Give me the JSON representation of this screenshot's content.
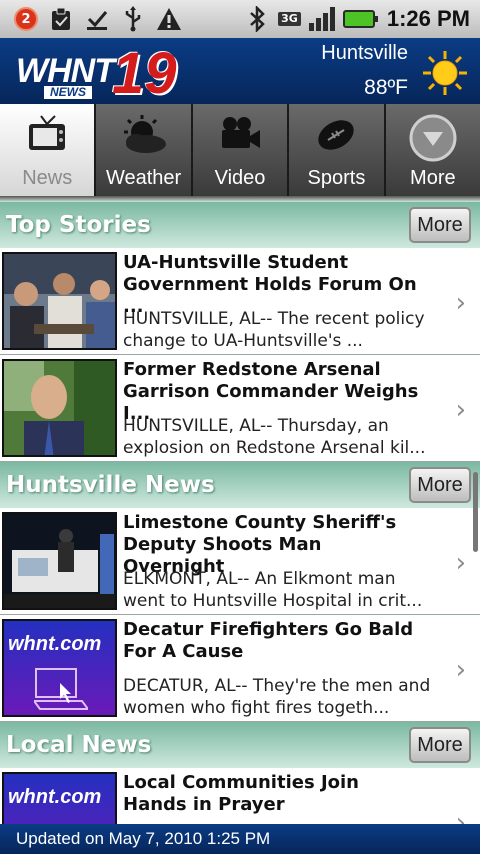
{
  "status_bar": {
    "notification_count": "2",
    "network_label": "3G",
    "time": "1:26 PM",
    "icons": [
      "notification-badge",
      "clipboard-icon",
      "download-done-icon",
      "usb-icon",
      "warning-icon",
      "bluetooth-icon",
      "3g-icon",
      "signal-icon",
      "battery-icon"
    ]
  },
  "header": {
    "logo_text": "WHNT",
    "logo_number": "19",
    "logo_subtext": "NEWS",
    "city": "Huntsville",
    "temperature": "88ºF",
    "weather_icon": "sun-icon"
  },
  "tabs": [
    {
      "label": "News",
      "icon": "tv-icon",
      "active": true
    },
    {
      "label": "Weather",
      "icon": "cloud-sun-icon",
      "active": false
    },
    {
      "label": "Video",
      "icon": "video-camera-icon",
      "active": false
    },
    {
      "label": "Sports",
      "icon": "football-icon",
      "active": false
    },
    {
      "label": "More",
      "icon": "more-down-icon",
      "active": false
    }
  ],
  "sections": [
    {
      "title": "Top Stories",
      "more_label": "More",
      "stories": [
        {
          "title": "UA-Huntsville Student Government Holds Forum On ...",
          "desc": "HUNTSVILLE, AL-- The recent policy change to UA-Huntsville's ..."
        },
        {
          "title": "Former Redstone Arsenal Garrison Commander Weighs I...",
          "desc": "HUNTSVILLE, AL-- Thursday, an explosion on Redstone Arsenal kil..."
        }
      ]
    },
    {
      "title": "Huntsville News",
      "more_label": "More",
      "stories": [
        {
          "title": "Limestone County Sheriff's Deputy Shoots Man Overnight",
          "desc": "ELKMONT, AL-- An Elkmont man went to Huntsville Hospital in crit..."
        },
        {
          "title": "Decatur Firefighters Go Bald For A Cause",
          "desc": "DECATUR, AL-- They're the men and women who fight fires togeth...",
          "thumb_text": "whnt.com"
        }
      ]
    },
    {
      "title": "Local News",
      "more_label": "More",
      "stories": [
        {
          "title": "Local Communities Join Hands in Prayer",
          "desc": "",
          "thumb_text": "whnt.com"
        }
      ]
    }
  ],
  "footer": {
    "updated_text": "Updated on May 7, 2010 1:25 PM"
  },
  "colors": {
    "header_blue": "#0b3c85",
    "section_green": "#7bb8a2",
    "logo_red": "#d41c1c"
  }
}
